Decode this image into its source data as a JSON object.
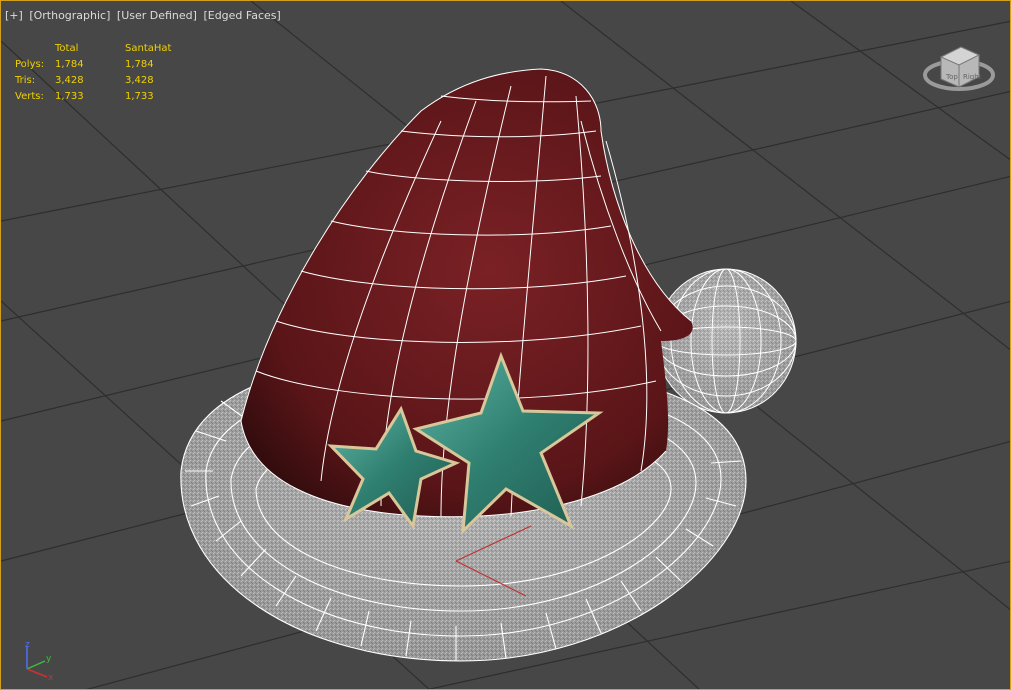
{
  "viewport": {
    "labels": [
      "[+]",
      "[Orthographic]",
      "[User Defined]",
      "[Edged Faces]"
    ],
    "border_color": "#d4a017"
  },
  "stats": {
    "headers": [
      "",
      "Total",
      "SantaHat"
    ],
    "rows": [
      {
        "label": "Polys:",
        "total": "1,784",
        "object": "1,784"
      },
      {
        "label": "Tris:",
        "total": "3,428",
        "object": "3,428"
      },
      {
        "label": "Verts:",
        "total": "1,733",
        "object": "1,733"
      }
    ],
    "color": "#f0d000"
  },
  "viewcube": {
    "faces": [
      "Top",
      "Right"
    ]
  },
  "axis_tripod": {
    "axes": [
      "z",
      "y",
      "x"
    ]
  },
  "colors": {
    "hat": "#6e1a1c",
    "fur": "#c8c8c8",
    "star": "#3f8f80",
    "wire": "#ffffff",
    "grid": "#2b2b2b"
  }
}
